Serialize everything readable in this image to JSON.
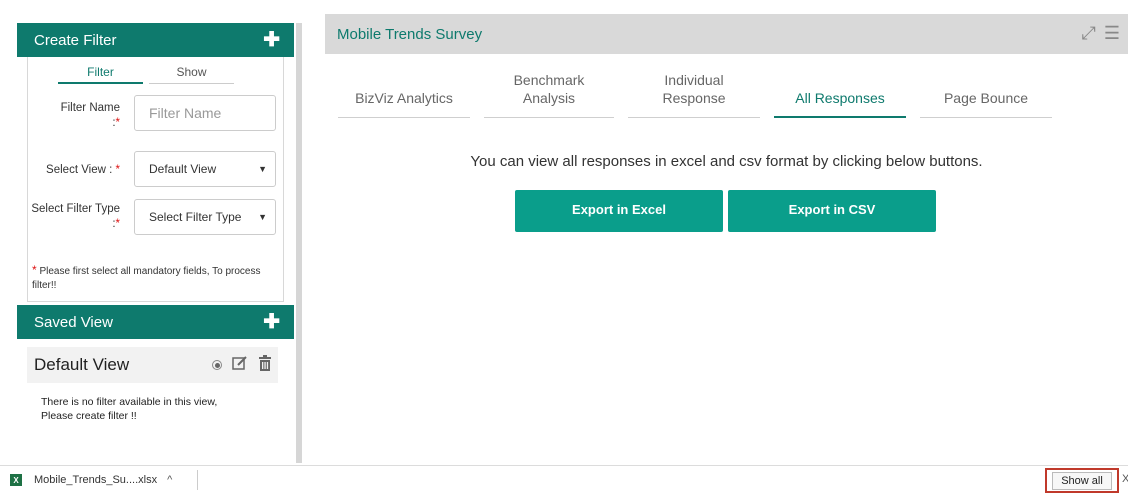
{
  "create_filter": {
    "title": "Create Filter",
    "add_icon": "plus-icon",
    "tabs": [
      "Filter",
      "Show"
    ],
    "active_tab": "Filter",
    "filter_name_label": "Filter Name",
    "filter_name_colon": ":",
    "filter_name_placeholder": "Filter Name",
    "select_view_label": "Select View :",
    "select_view_value": "Default View",
    "filter_type_label": "Select Filter Type",
    "filter_type_colon": ":",
    "filter_type_value": "Select Filter Type",
    "required_mark": "*",
    "note": "Please first select all mandatory fields, To process filter!!"
  },
  "saved_view": {
    "title": "Saved View",
    "view_name": "Default View",
    "empty_message_line1": "There is no filter available in this view,",
    "empty_message_line2": "Please create filter !!"
  },
  "main": {
    "title": "Mobile Trends Survey",
    "tabs": [
      {
        "label": "BizViz Analytics"
      },
      {
        "label": "Benchmark Analysis"
      },
      {
        "label": "Individual Response"
      },
      {
        "label": "All Responses"
      },
      {
        "label": "Page Bounce"
      }
    ],
    "active_tab": "All Responses",
    "message": "You can view all responses in excel and csv format by clicking below buttons.",
    "export_excel": "Export in Excel",
    "export_csv": "Export in CSV"
  },
  "download_bar": {
    "file_name": "Mobile_Trends_Su....xlsx",
    "caret": "^",
    "show_all": "Show all",
    "close": "X"
  },
  "colors": {
    "header_green": "#0e7a6d",
    "button_teal": "#0a9e8b",
    "highlight_red": "#c0392b"
  }
}
